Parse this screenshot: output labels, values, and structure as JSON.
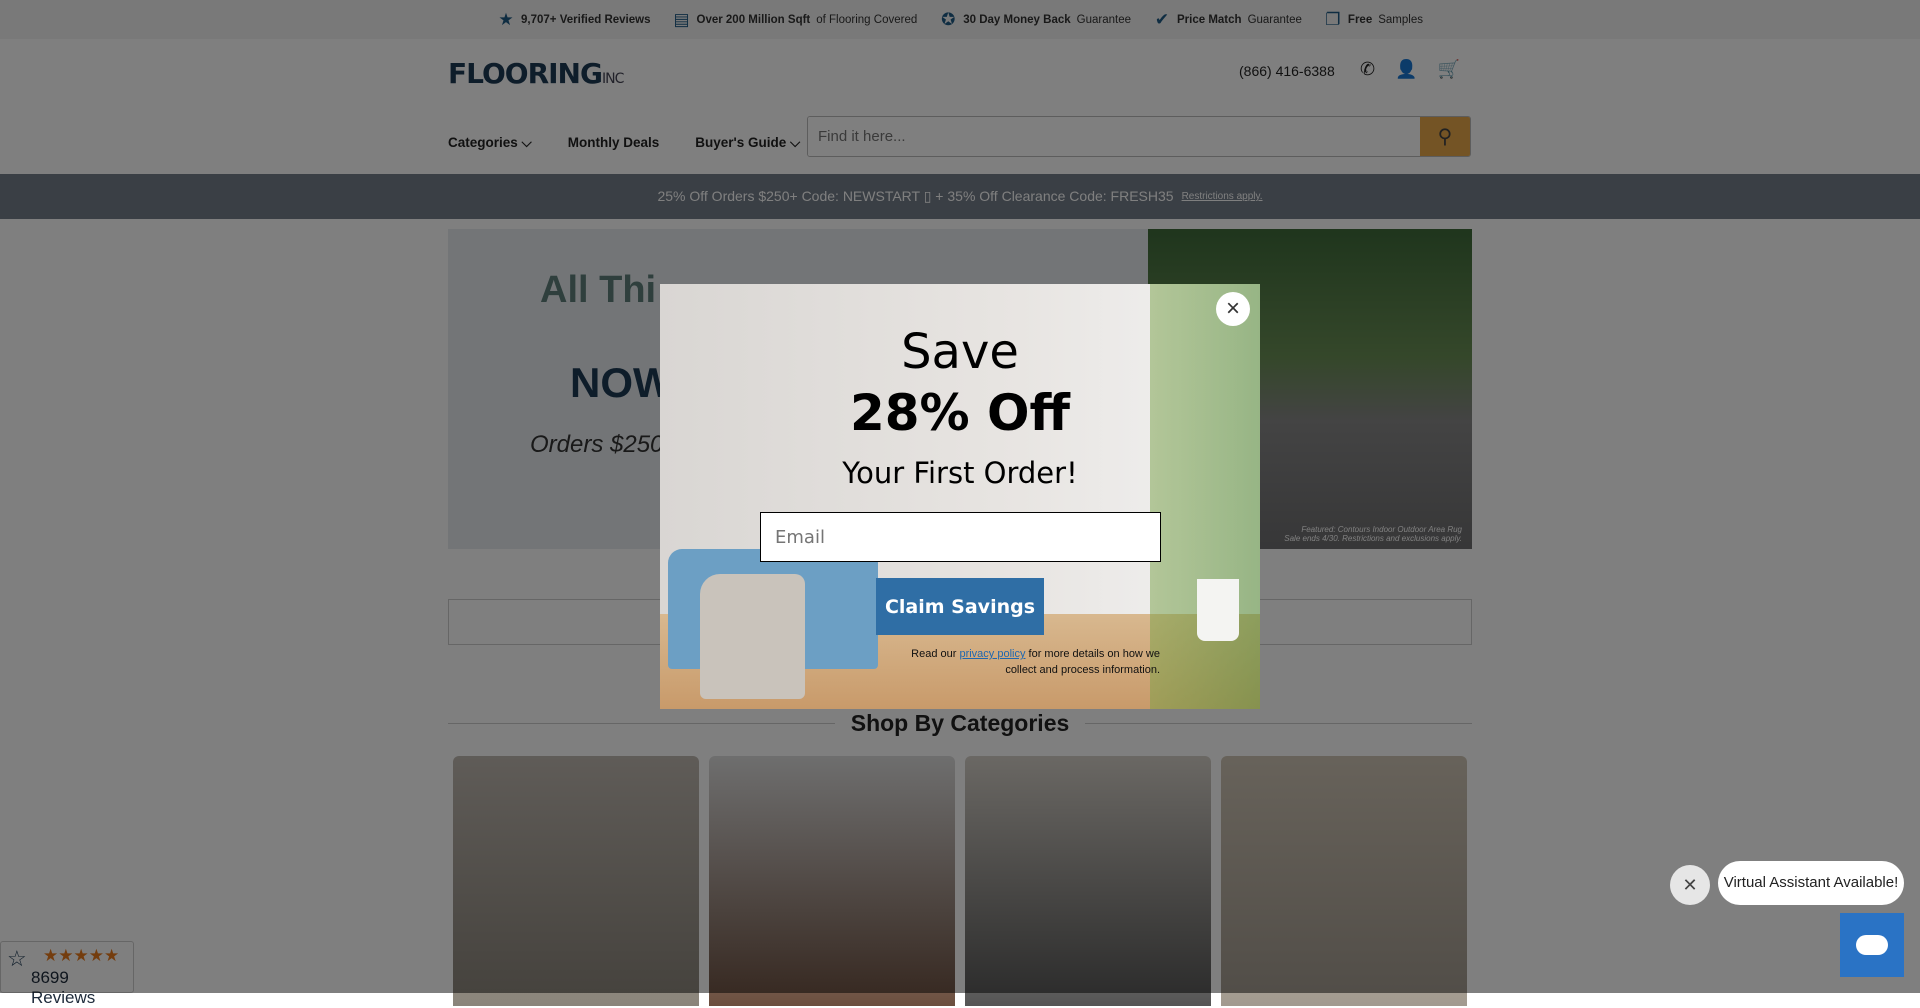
{
  "topbar": [
    {
      "icon": "star-icon",
      "bold": "9,707+ Verified Reviews",
      "rest": ""
    },
    {
      "icon": "document-icon",
      "bold": "Over 200 Million Sqft",
      "rest": " of Flooring Covered"
    },
    {
      "icon": "badge-icon",
      "bold": "30 Day Money Back",
      "rest": " Guarantee"
    },
    {
      "icon": "checkmark-icon",
      "bold": "Price Match",
      "rest": " Guarantee"
    },
    {
      "icon": "samples-icon",
      "bold": "Free",
      "rest": " Samples"
    }
  ],
  "header": {
    "logo": "FLOORING",
    "logo_suffix": "INC",
    "phone": "(866) 416-6388"
  },
  "nav": [
    {
      "label": "Categories ⌵"
    },
    {
      "label": "Monthly Deals"
    },
    {
      "label": "Buyer's Guide ⌵"
    }
  ],
  "search": {
    "placeholder": "Find it here..."
  },
  "promo": {
    "text": "25% Off Orders $250+ Code: NEWSTART ▯ + 35% Off Clearance Code: FRESH35",
    "link": "Restrictions apply."
  },
  "hero": {
    "line1": "All Thi",
    "line2": "NOW",
    "line3": "Orders $250",
    "caption": "Featured: Contours Indoor Outdoor Area Rug\nSale ends 4/30. Restrictions and exclusions apply."
  },
  "section_title": "Shop By Categories",
  "reviews": {
    "stars": "★★★★★",
    "count": "8699 Reviews",
    "rating": 5
  },
  "modal": {
    "save": "Save",
    "off": "28% Off",
    "first": "Your First Order!",
    "email_placeholder": "Email",
    "claim": "Claim Savings",
    "legal_pre": "Read our ",
    "legal_link": "privacy policy",
    "legal_post": " for more details on how we collect and process information."
  },
  "chat": {
    "bubble": "Virtual Assistant Available!"
  },
  "colors": {
    "accent": "#2f6ea5",
    "search_button": "#e8a94a",
    "brand": "#1d3a55",
    "chat": "#2a73c5"
  }
}
